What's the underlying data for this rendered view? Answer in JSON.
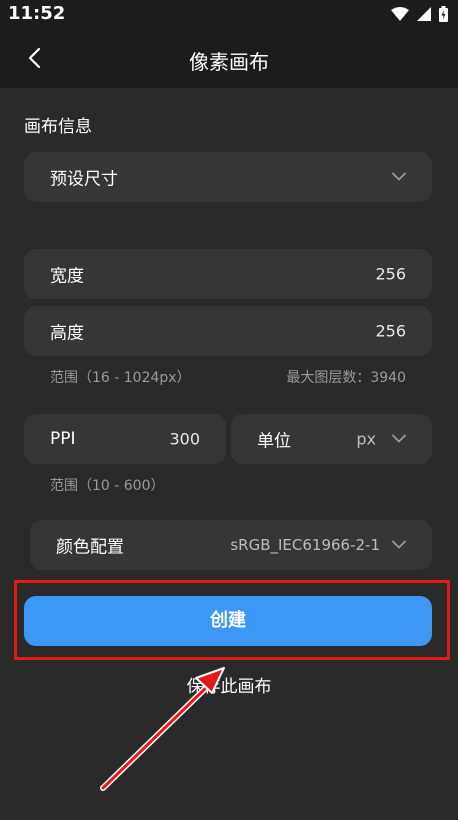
{
  "status": {
    "time": "11:52"
  },
  "header": {
    "title": "像素画布"
  },
  "section": {
    "title": "画布信息"
  },
  "preset": {
    "label": "预设尺寸"
  },
  "width": {
    "label": "宽度",
    "value": "256"
  },
  "height": {
    "label": "高度",
    "value": "256"
  },
  "size_hint": {
    "range": "范围（16 - 1024px）",
    "max_layers_label": "最大图层数：",
    "max_layers_value": "3940"
  },
  "ppi": {
    "label": "PPI",
    "value": "300",
    "hint": "范围（10 - 600）"
  },
  "unit": {
    "label": "单位",
    "value": "px"
  },
  "color_profile": {
    "label": "颜色配置",
    "value": "sRGB_IEC61966-2-1"
  },
  "actions": {
    "create_label": "创建",
    "save_label": "保存此画布"
  },
  "colors": {
    "accent": "#3d98f5",
    "highlight": "#e31a1a",
    "background": "#2a2a2a"
  }
}
